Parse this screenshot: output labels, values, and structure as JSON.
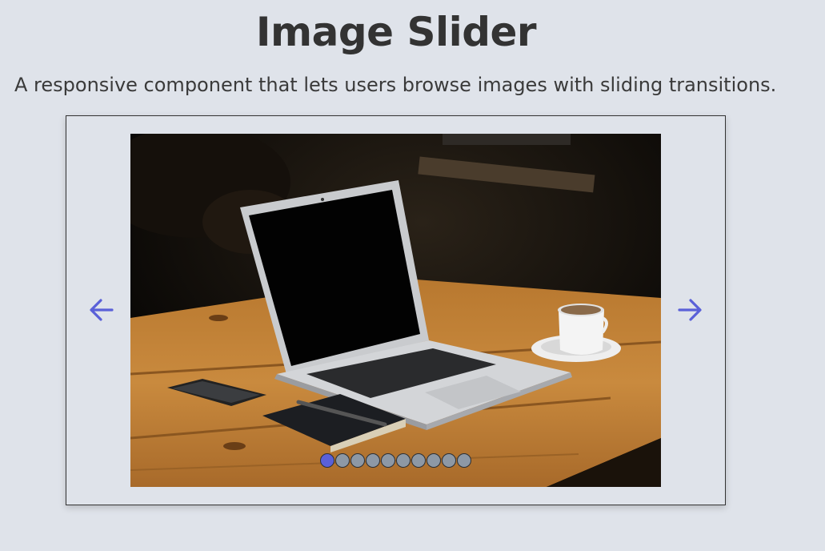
{
  "header": {
    "title": "Image Slider",
    "subtitle": "A responsive component that lets users browse images with sliding transitions."
  },
  "slider": {
    "prev_icon": "arrow-left-icon",
    "next_icon": "arrow-right-icon",
    "accent_color": "#5a60d8",
    "dot_inactive_color": "#8d98a5",
    "slide_count": 10,
    "active_index": 0,
    "current_image": "laptop-on-wooden-table-photo"
  }
}
